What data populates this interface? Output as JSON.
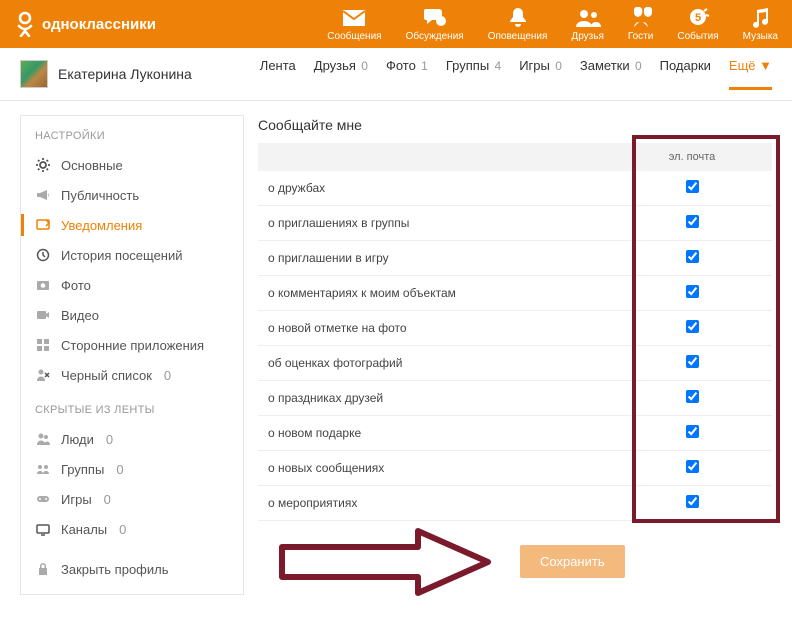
{
  "brand": "одноклассники",
  "header_nav": [
    {
      "label": "Сообщения",
      "icon": "mail-icon"
    },
    {
      "label": "Обсуждения",
      "icon": "chat-icon"
    },
    {
      "label": "Оповещения",
      "icon": "bell-icon"
    },
    {
      "label": "Друзья",
      "icon": "friends-icon"
    },
    {
      "label": "Гости",
      "icon": "guests-icon"
    },
    {
      "label": "События",
      "icon": "events-icon"
    },
    {
      "label": "Музыка",
      "icon": "music-icon"
    }
  ],
  "profile_name": "Екатерина Луконина",
  "subnav": [
    {
      "label": "Лента",
      "count": ""
    },
    {
      "label": "Друзья",
      "count": "0"
    },
    {
      "label": "Фото",
      "count": "1"
    },
    {
      "label": "Группы",
      "count": "4"
    },
    {
      "label": "Игры",
      "count": "0"
    },
    {
      "label": "Заметки",
      "count": "0"
    },
    {
      "label": "Подарки",
      "count": ""
    },
    {
      "label": "Ещё ▼",
      "count": "",
      "active": true
    }
  ],
  "sidebar": {
    "title1": "НАСТРОЙКИ",
    "items1": [
      {
        "label": "Основные",
        "icon": "gear-icon"
      },
      {
        "label": "Публичность",
        "icon": "megaphone-icon"
      },
      {
        "label": "Уведомления",
        "icon": "notify-icon",
        "active": true
      },
      {
        "label": "История посещений",
        "icon": "history-icon"
      },
      {
        "label": "Фото",
        "icon": "camera-icon"
      },
      {
        "label": "Видео",
        "icon": "video-icon"
      },
      {
        "label": "Сторонние приложения",
        "icon": "apps-icon"
      },
      {
        "label": "Черный список",
        "icon": "blacklist-icon",
        "count": "0"
      }
    ],
    "title2": "СКРЫТЫЕ ИЗ ЛЕНТЫ",
    "items2": [
      {
        "label": "Люди",
        "icon": "people-icon",
        "count": "0"
      },
      {
        "label": "Группы",
        "icon": "groups-icon",
        "count": "0"
      },
      {
        "label": "Игры",
        "icon": "gamepad-icon",
        "count": "0"
      },
      {
        "label": "Каналы",
        "icon": "tv-icon",
        "count": "0"
      }
    ],
    "close_profile": "Закрыть профиль"
  },
  "main": {
    "heading": "Сообщайте мне",
    "column_email": "эл. почта",
    "rows": [
      {
        "label": "о дружбах",
        "checked": true
      },
      {
        "label": "о приглашениях в группы",
        "checked": true
      },
      {
        "label": "о приглашении в игру",
        "checked": true
      },
      {
        "label": "о комментариях к моим объектам",
        "checked": true
      },
      {
        "label": "о новой отметке на фото",
        "checked": true
      },
      {
        "label": "об оценках фотографий",
        "checked": true
      },
      {
        "label": "о праздниках друзей",
        "checked": true
      },
      {
        "label": "о новом подарке",
        "checked": true
      },
      {
        "label": "о новых сообщениях",
        "checked": true
      },
      {
        "label": "о мероприятиях",
        "checked": true
      }
    ],
    "save_label": "Сохранить"
  }
}
